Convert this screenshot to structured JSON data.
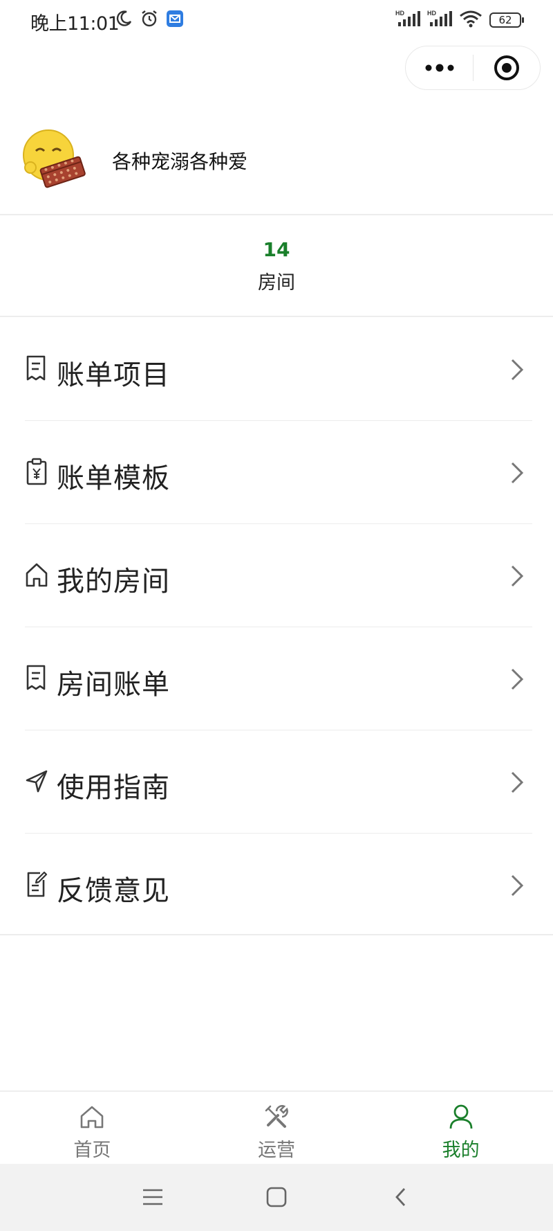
{
  "status_bar": {
    "time": "晚上11:01",
    "battery_level": "62",
    "left_icons": [
      "moon-icon",
      "alarm-icon",
      "mail-app-icon"
    ],
    "right_icons": [
      "signal-hd-icon",
      "signal-hd-icon",
      "wifi-icon",
      "battery-icon"
    ]
  },
  "capsule": {
    "more_icon": "more-dots-icon",
    "close_icon": "target-close-icon"
  },
  "profile": {
    "nickname": "各种宠溺各种爱",
    "avatar_icon": "emoji-abacus-avatar"
  },
  "stats": {
    "rooms_value": "14",
    "rooms_label": "房间",
    "accent_color": "#1a7f2b"
  },
  "menu": {
    "items": [
      {
        "label": "账单项目",
        "icon": "bill-icon"
      },
      {
        "label": "账单模板",
        "icon": "clipboard-yen-icon"
      },
      {
        "label": "我的房间",
        "icon": "home-icon"
      },
      {
        "label": "房间账单",
        "icon": "bill-icon"
      },
      {
        "label": "使用指南",
        "icon": "navigation-arrow-icon"
      },
      {
        "label": "反馈意见",
        "icon": "edit-note-icon"
      }
    ]
  },
  "tabbar": {
    "tabs": [
      {
        "label": "首页",
        "icon": "home-icon",
        "active": false
      },
      {
        "label": "运营",
        "icon": "tools-icon",
        "active": false
      },
      {
        "label": "我的",
        "icon": "user-icon",
        "active": true
      }
    ]
  },
  "navbar": {
    "icons": [
      "menu-lines-icon",
      "home-square-icon",
      "back-icon"
    ]
  }
}
